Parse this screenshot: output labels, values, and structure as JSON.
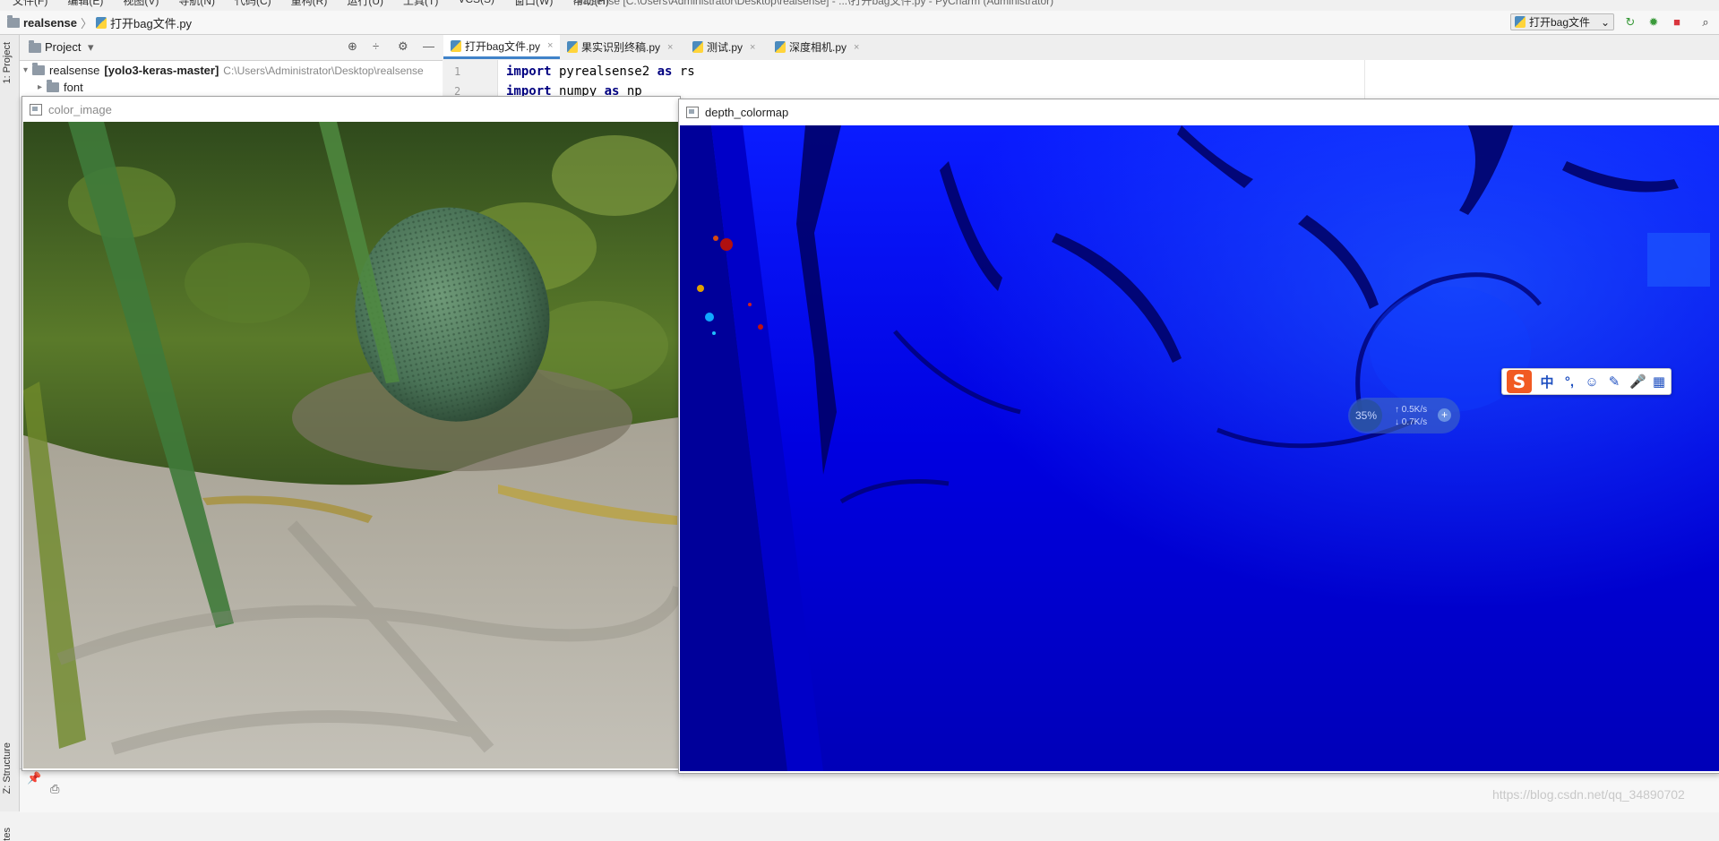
{
  "menubar": {
    "items": [
      "文件(F)",
      "编辑(E)",
      "视图(V)",
      "导航(N)",
      "代码(C)",
      "重构(R)",
      "运行(U)",
      "工具(T)",
      "VCS(S)",
      "窗口(W)",
      "帮助(H)"
    ],
    "window_title": "realsense [C:\\Users\\Administrator\\Desktop\\realsense] - ...\\打开bag文件.py - PyCharm (Administrator)"
  },
  "navbar": {
    "project": "realsense",
    "separator": "〉",
    "file": "打开bag文件.py",
    "run_config": "打开bag文件",
    "run_config_caret": "⌄",
    "rerun_icon": "↻",
    "debug_icon": "✹",
    "stop_icon": "■",
    "search_icon": "⌕"
  },
  "left_strip": {
    "project_tab": "1: Project",
    "structure_tab": "Z: Structure",
    "favorites_tab": "tes"
  },
  "project_panel": {
    "title": "Project",
    "caret": "▾",
    "locate_icon": "⊕",
    "collapse_icon": "÷",
    "settings_icon": "⚙",
    "hide_icon": "—",
    "root_name": "realsense",
    "root_module": "[yolo3-keras-master]",
    "root_path": "C:\\Users\\Administrator\\Desktop\\realsense",
    "child_folder": "font"
  },
  "editor_tabs": [
    {
      "label": "打开bag文件.py",
      "active": true
    },
    {
      "label": "果实识别终稿.py",
      "active": false
    },
    {
      "label": "测试.py",
      "active": false
    },
    {
      "label": "深度相机.py",
      "active": false
    }
  ],
  "tab_close": "×",
  "editor": {
    "line_numbers": [
      "1",
      "2"
    ],
    "line1": {
      "kw1": "import",
      "mod": " pyrealsense2 ",
      "kw2": "as",
      "alias": " rs"
    },
    "line2": {
      "kw1": "import",
      "mod": " numpy ",
      "kw2": "as",
      "alias": " np"
    }
  },
  "color_window": {
    "title": "color_image"
  },
  "depth_window": {
    "title": "depth_colormap"
  },
  "ime": {
    "logo": "S",
    "items": [
      "中",
      "°,",
      "☺",
      "✎",
      "🎤",
      "▦"
    ]
  },
  "net_widget": {
    "percent": "35%",
    "up": "↑ 0.5K/s",
    "down": "↓ 0.7K/s",
    "plus": "+"
  },
  "watermark": "https://blog.csdn.net/qq_34890702",
  "colors": {
    "accent": "#4083c9",
    "depth_blue": "#0000e6",
    "depth_dark": "#00008f",
    "ime_orange": "#f15a22"
  }
}
